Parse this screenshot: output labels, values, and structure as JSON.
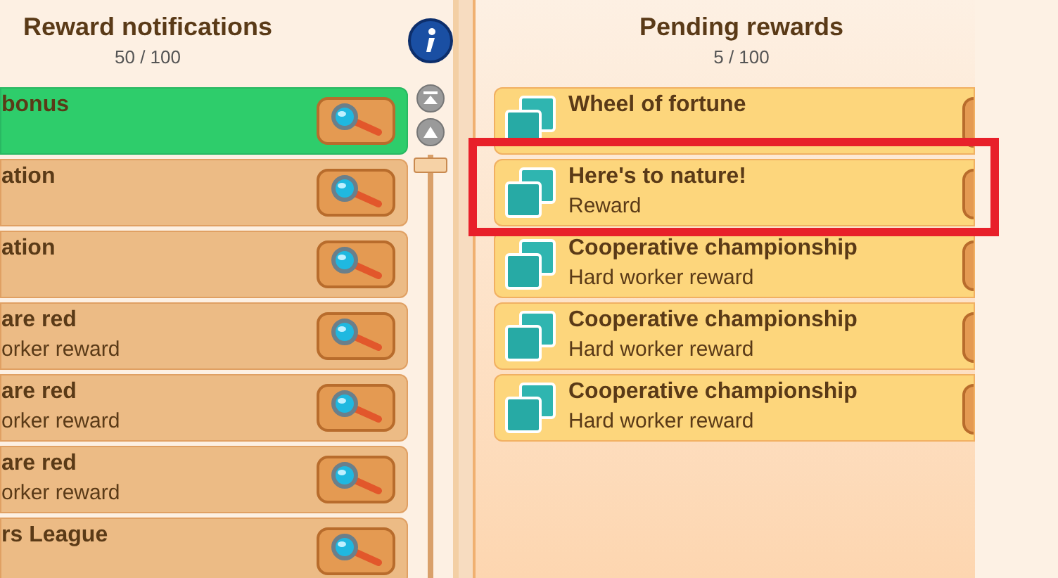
{
  "notifications": {
    "title": "Reward notifications",
    "count": "50 / 100",
    "items": [
      {
        "title": "bonus",
        "selected": true
      },
      {
        "title": "ation",
        "selected": false
      },
      {
        "title": "ation",
        "selected": false
      },
      {
        "title": "are red",
        "subtitle": "orker reward",
        "selected": false
      },
      {
        "title": "are red",
        "subtitle": "orker reward",
        "selected": false
      },
      {
        "title": "are red",
        "subtitle": "orker reward",
        "selected": false
      },
      {
        "title": "rs League",
        "selected": false
      }
    ]
  },
  "pending": {
    "title": "Pending rewards",
    "count": "5 / 100",
    "items": [
      {
        "title": "Wheel of fortune",
        "highlighted": false
      },
      {
        "title": "Here's to nature!",
        "subtitle": "Reward",
        "highlighted": true
      },
      {
        "title": "Cooperative championship",
        "subtitle": "Hard worker reward",
        "highlighted": false
      },
      {
        "title": "Cooperative championship",
        "subtitle": "Hard worker reward",
        "highlighted": false
      },
      {
        "title": "Cooperative championship",
        "subtitle": "Hard worker reward",
        "highlighted": false
      }
    ]
  }
}
